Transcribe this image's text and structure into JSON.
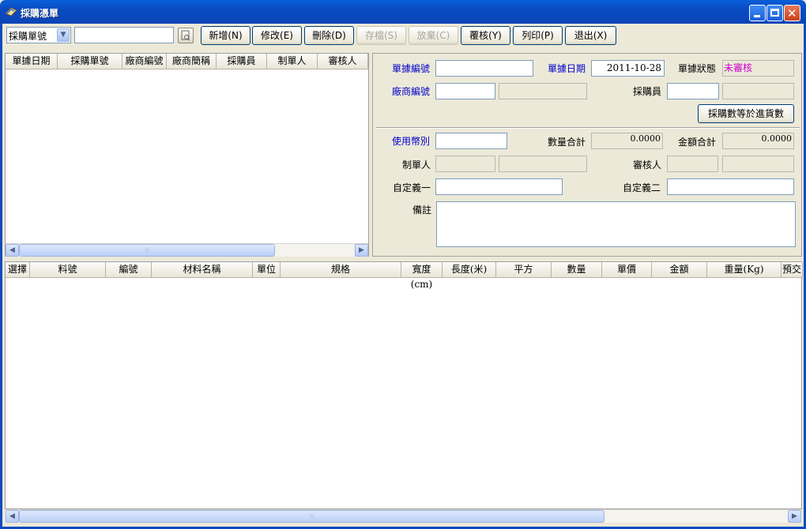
{
  "window": {
    "title": "採購憑單"
  },
  "toolbar": {
    "search_field_select": "採購單號",
    "search_input_value": "",
    "buttons": [
      {
        "label": "新增(N)",
        "enabled": true
      },
      {
        "label": "修改(E)",
        "enabled": true
      },
      {
        "label": "刪除(D)",
        "enabled": true
      },
      {
        "label": "存檔(S)",
        "enabled": false
      },
      {
        "label": "放棄(C)",
        "enabled": false
      },
      {
        "label": "覆核(Y)",
        "enabled": true
      },
      {
        "label": "列印(P)",
        "enabled": true
      },
      {
        "label": "退出(X)",
        "enabled": true
      }
    ]
  },
  "order_list": {
    "columns": [
      "單據日期",
      "採購單號",
      "廠商編號",
      "廠商簡稱",
      "採購員",
      "制單人",
      "審核人"
    ]
  },
  "form": {
    "doc_no_label": "單據編號",
    "doc_no_value": "",
    "doc_date_label": "單據日期",
    "doc_date_value": "2011-10-28",
    "doc_status_label": "單據狀態",
    "doc_status_value": "未審核",
    "vendor_no_label": "廠商編號",
    "vendor_no_value": "",
    "vendor_name_value": "",
    "buyer_label": "採購員",
    "buyer_value": "",
    "buyer_name_value": "",
    "equal_button_label": "採購數等於進貨數",
    "currency_label": "使用幣別",
    "currency_value": "",
    "qty_total_label": "數量合計",
    "qty_total_value": "0.0000",
    "amount_total_label": "金額合計",
    "amount_total_value": "0.0000",
    "creator_label": "制單人",
    "creator_value": "",
    "creator_name_value": "",
    "auditor_label": "審核人",
    "auditor_value": "",
    "auditor_name_value": "",
    "custom1_label": "自定義一",
    "custom1_value": "",
    "custom2_label": "自定義二",
    "custom2_value": "",
    "remark_label": "備註",
    "remark_value": ""
  },
  "detail_grid": {
    "columns": [
      "選擇",
      "料號",
      "編號",
      "材料名稱",
      "單位",
      "規格",
      "寬度(cm)",
      "長度(米)",
      "平方",
      "數量",
      "單價",
      "金額",
      "重量(Kg)",
      "預交"
    ]
  },
  "colors": {
    "title_bar": "#0a4bc2",
    "status_text": "#cc00cc",
    "required_label": "#0000cc"
  }
}
